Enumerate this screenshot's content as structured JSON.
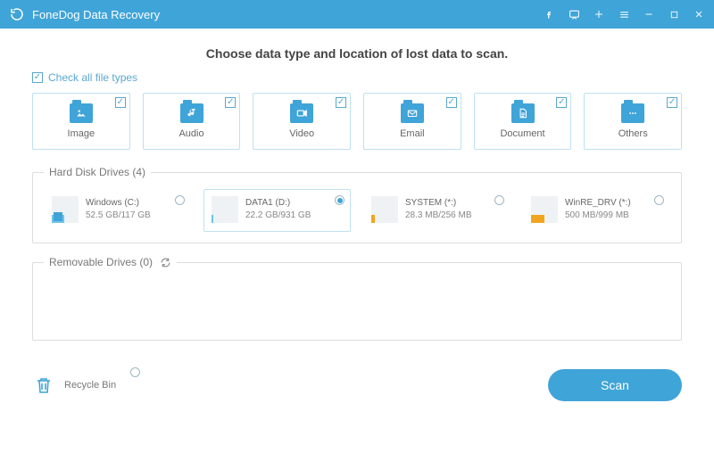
{
  "app": {
    "title": "FoneDog Data Recovery"
  },
  "headline": "Choose data type and location of lost data to scan.",
  "checkAllLabel": "Check all file types",
  "fileTypes": [
    {
      "label": "Image"
    },
    {
      "label": "Audio"
    },
    {
      "label": "Video"
    },
    {
      "label": "Email"
    },
    {
      "label": "Document"
    },
    {
      "label": "Others"
    }
  ],
  "sections": {
    "hdd": {
      "title": "Hard Disk Drives (4)"
    },
    "removable": {
      "title": "Removable Drives (0)"
    }
  },
  "drives": [
    {
      "name": "Windows (C:)",
      "size": "52.5 GB/117 GB",
      "fillColor": "#6ec3e8",
      "fillPct": 45,
      "osBadge": true
    },
    {
      "name": "DATA1 (D:)",
      "size": "22.2 GB/931 GB",
      "fillColor": "#6ec3e8",
      "fillPct": 6
    },
    {
      "name": "SYSTEM (*:)",
      "size": "28.3 MB/256 MB",
      "fillColor": "#f1a51f",
      "fillPct": 12
    },
    {
      "name": "WinRE_DRV (*:)",
      "size": "500 MB/999 MB",
      "fillColor": "#f1a51f",
      "fillPct": 50
    }
  ],
  "selectedDriveIndex": 1,
  "recycle": {
    "label": "Recycle Bin"
  },
  "scanLabel": "Scan"
}
